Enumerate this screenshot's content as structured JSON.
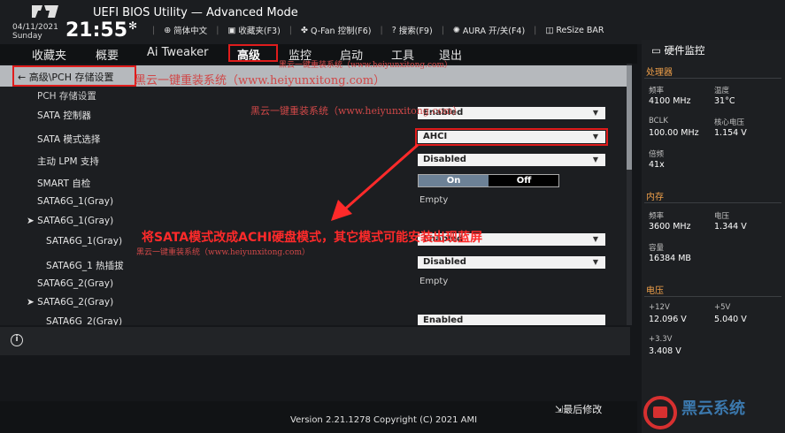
{
  "header": {
    "title": "UEFI BIOS Utility — Advanced Mode",
    "date": "04/11/2021",
    "weekday": "Sunday",
    "time": "21:55",
    "toolbar": [
      {
        "icon": "globe-icon",
        "label": "简体中文"
      },
      {
        "icon": "favorites-icon",
        "label": "收藏夹(F3)"
      },
      {
        "icon": "fan-icon",
        "label": "Q-Fan 控制(F6)"
      },
      {
        "icon": "help-icon",
        "label": "搜索(F9)"
      },
      {
        "icon": "aura-icon",
        "label": "AURA 开/关(F4)"
      },
      {
        "icon": "resize-bar-icon",
        "label": "ReSize BAR"
      }
    ]
  },
  "tabs": [
    "收藏夹",
    "概要",
    "Ai Tweaker",
    "高级",
    "监控",
    "启动",
    "工具",
    "退出"
  ],
  "active_tab": "高级",
  "breadcrumb": "高级\\PCH 存储设置",
  "settings": {
    "section_title": "PCH 存储设置",
    "sata_controller": {
      "label": "SATA 控制器",
      "value": "Enabled"
    },
    "sata_mode": {
      "label": "SATA 模式选择",
      "value": "AHCI"
    },
    "lpm": {
      "label": "主动 LPM 支持",
      "value": "Disabled"
    },
    "smart": {
      "label": "SMART 自检",
      "on": "On",
      "off": "Off"
    },
    "port1": {
      "label": "SATA6G_1(Gray)",
      "value": "Empty"
    },
    "port1_group": "SATA6G_1(Gray)",
    "port1_sub": {
      "label": "SATA6G_1(Gray)",
      "value": "Enabled"
    },
    "port1_hotplug": {
      "label": "SATA6G_1 热插拔",
      "value": "Disabled"
    },
    "port2": {
      "label": "SATA6G_2(Gray)",
      "value": "Empty"
    },
    "port2_group": "SATA6G_2(Gray)",
    "port2_sub": {
      "label": "SATA6G_2(Gray)",
      "value": "Enabled"
    }
  },
  "footer": {
    "version": "Version 2.21.1278 Copyright (C) 2021 AMI",
    "last_modified": "最后修改"
  },
  "monitor": {
    "title": "硬件监控",
    "cpu": {
      "title": "处理器",
      "freq_label": "频率",
      "freq": "4100 MHz",
      "temp_label": "温度",
      "temp": "31°C",
      "bclk_label": "BCLK",
      "bclk": "100.00 MHz",
      "vcore_label": "核心电压",
      "vcore": "1.154 V",
      "ratio_label": "倍频",
      "ratio": "41x"
    },
    "memory": {
      "title": "内存",
      "freq_label": "频率",
      "freq": "3600 MHz",
      "volt_label": "电压",
      "volt": "1.344 V",
      "cap_label": "容量",
      "cap": "16384 MB"
    },
    "voltage": {
      "title": "电压",
      "v12_label": "+12V",
      "v12": "12.096 V",
      "v5_label": "+5V",
      "v5": "5.040 V",
      "v33_label": "+3.3V",
      "v33": "3.408 V"
    }
  },
  "annotations": {
    "watermark": "黑云一键重装系统（www.heiyunxitong.com）",
    "caption": "将SATA模式改成ACHI硬盘模式，其它模式可能安装出现蓝屏",
    "brand": "黑云系统"
  },
  "colors": {
    "highlight": "#e01c1c",
    "accent": "#f0a04a",
    "caption": "#ff2a2a"
  }
}
